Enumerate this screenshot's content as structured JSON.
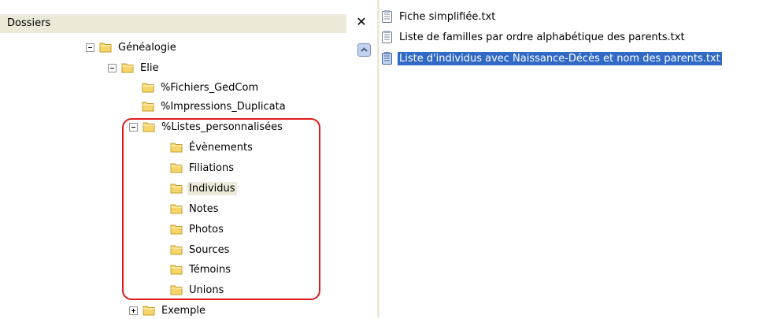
{
  "folders_pane": {
    "title": "Dossiers",
    "close_glyph": "✕",
    "tree": [
      {
        "label": "Généalogie",
        "expander": "minus"
      },
      {
        "label": "Elie",
        "expander": "minus"
      },
      {
        "label": "%Fichiers_GedCom",
        "expander": "none"
      },
      {
        "label": "%Impressions_Duplicata",
        "expander": "none"
      },
      {
        "label": "%Listes_personnalisées",
        "expander": "minus"
      },
      {
        "label": "Évènements",
        "expander": "none"
      },
      {
        "label": "Filiations",
        "expander": "none"
      },
      {
        "label": "Individus",
        "expander": "none",
        "highlighted": true
      },
      {
        "label": "Notes",
        "expander": "none"
      },
      {
        "label": "Photos",
        "expander": "none"
      },
      {
        "label": "Sources",
        "expander": "none"
      },
      {
        "label": "Témoins",
        "expander": "none"
      },
      {
        "label": "Unions",
        "expander": "none"
      },
      {
        "label": "Exemple",
        "expander": "plus"
      }
    ]
  },
  "files_pane": {
    "files": [
      {
        "name": "Fiche simplifiée.txt",
        "selected": false
      },
      {
        "name": "Liste de familles par ordre alphabétique des parents.txt",
        "selected": false
      },
      {
        "name": "Liste d'individus avec Naissance-Décès et nom des parents.txt",
        "selected": true
      }
    ]
  },
  "colors": {
    "selection": "#316ac5",
    "annotation_outline": "#e01b1b",
    "folder_yellow": "#f6d56a"
  }
}
